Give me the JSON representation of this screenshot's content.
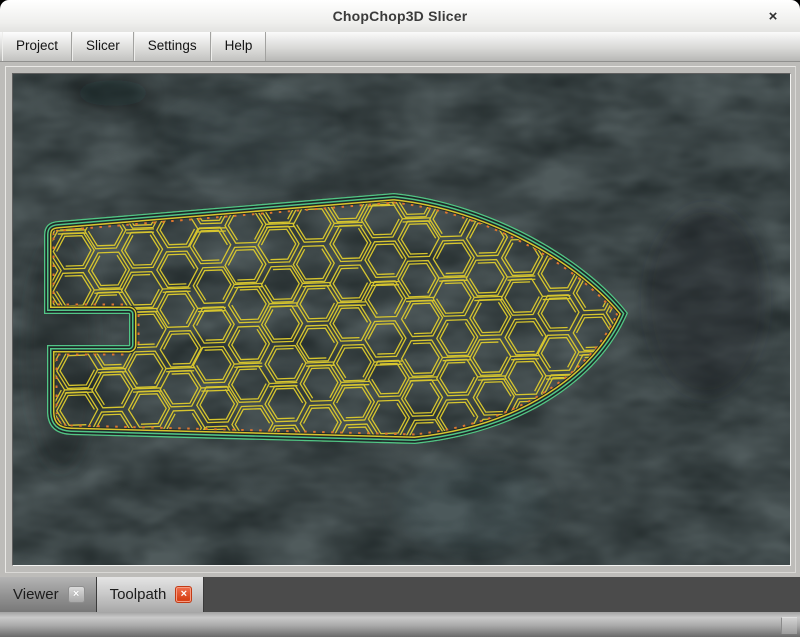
{
  "window": {
    "title": "ChopChop3D Slicer",
    "close_glyph": "×"
  },
  "menu": {
    "items": [
      {
        "label": "Project"
      },
      {
        "label": "Slicer"
      },
      {
        "label": "Settings"
      },
      {
        "label": "Help"
      }
    ]
  },
  "tabs": {
    "items": [
      {
        "label": "Viewer",
        "active": false
      },
      {
        "label": "Toolpath",
        "active": true
      }
    ],
    "close_glyph": "×"
  },
  "toolpath": {
    "pattern": "honeycomb-infill",
    "perimeter_color": "#52c586",
    "infill_color": "#d6c52e",
    "overhang_tick_color": "#e0762f",
    "canvas_background": "#1f2728"
  }
}
